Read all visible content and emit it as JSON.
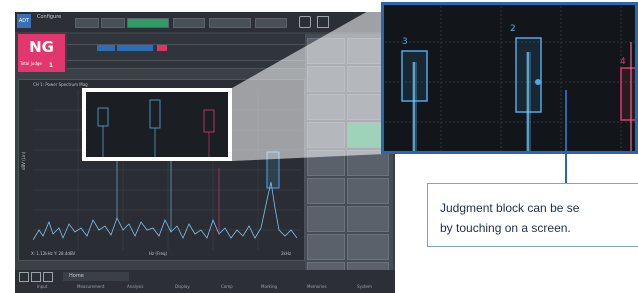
{
  "app": {
    "logo": "ADT",
    "status_text": "Configure",
    "result_badge": "NG",
    "result_sub": "Total Judge",
    "result_count": "1",
    "plot_title": "CH 1: Power Spectrum Mag",
    "y_axis_label": "dBV (Lin)",
    "x_axis_label": "Hz (Freq)",
    "cursor_readout": "X: 1.12kHz  Y: 28.4dBV",
    "x_tick_right": "2kHz",
    "bottom_tab": "Home",
    "menus": [
      "Input",
      "Measurement",
      "Analysis",
      "Display",
      "Comp",
      "Marking",
      "Memories",
      "System"
    ]
  },
  "zoom": {
    "block_labels": [
      "3",
      "2",
      "4"
    ],
    "block_colors": [
      "#4fa8e6",
      "#4fa8e6",
      "#e2376e"
    ],
    "frame_color": "#2b66b1"
  },
  "callout": {
    "line1": "Judgment block can be se",
    "line2": "by touching on a screen."
  }
}
